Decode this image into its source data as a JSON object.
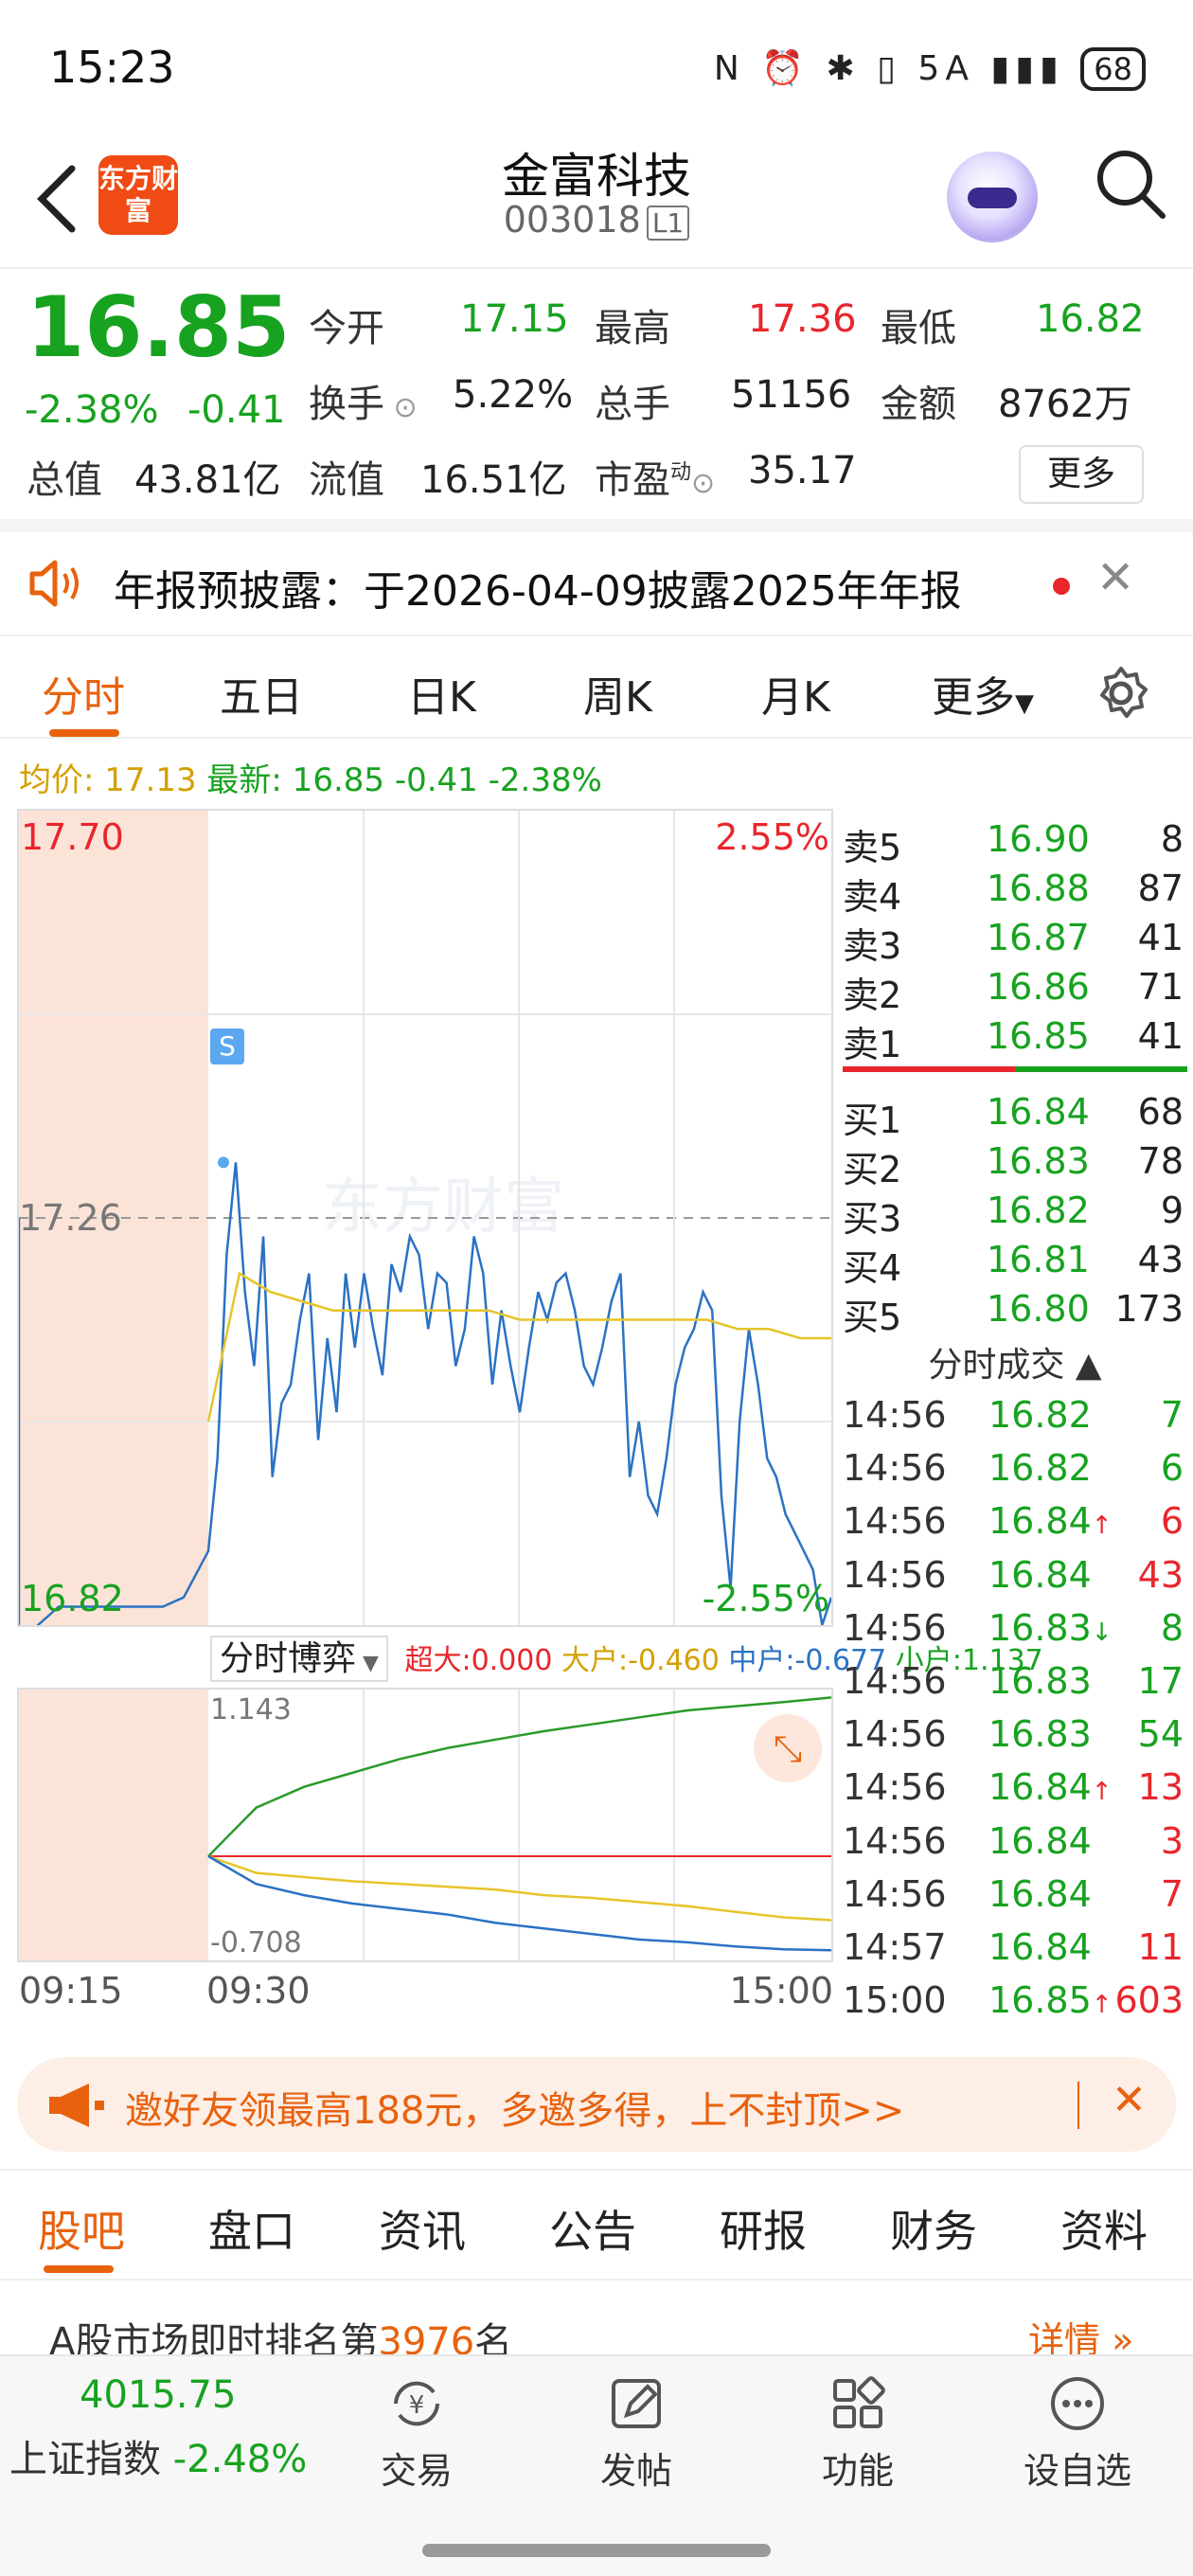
{
  "status": {
    "time": "15:23",
    "icons": "N ⏰ ✱ ▯ 5A ▮▮▮",
    "battery": "68"
  },
  "header": {
    "logo": "东方财富",
    "name": "金富科技",
    "code": "003018",
    "level": "L1"
  },
  "quote": {
    "price": "16.85",
    "pct": "-2.38%",
    "chg": "-0.41",
    "open_l": "今开",
    "open_v": "17.15",
    "high_l": "最高",
    "high_v": "17.36",
    "low_l": "最低",
    "low_v": "16.82",
    "turn_l": "换手",
    "turn_v": "5.22%",
    "vol_l": "总手",
    "vol_v": "51156",
    "amt_l": "金额",
    "amt_v": "8762万",
    "cap_l": "总值",
    "cap_v": "43.81亿",
    "fcap_l": "流值",
    "fcap_v": "16.51亿",
    "pe_l": "市盈",
    "pe_sup": "动",
    "pe_v": "35.17",
    "more": "更多"
  },
  "notice": {
    "text": "年报预披露：于2026-04-09披露2025年年报"
  },
  "tabs": [
    "分时",
    "五日",
    "日K",
    "周K",
    "月K",
    "更多"
  ],
  "legend": {
    "avg": "均价: 17.13",
    "latest": "最新: 16.85 -0.41 -2.38%"
  },
  "chart_data": {
    "type": "line",
    "top_price": "17.70",
    "top_pct": "2.55%",
    "mid_price": "17.26",
    "bot_price": "16.82",
    "bot_pct": "-2.55%",
    "marker": "S",
    "series": [
      {
        "values": [
          16.82,
          16.84,
          16.84,
          16.84,
          16.84,
          16.84,
          16.84,
          16.85,
          16.9,
          17.0,
          17.22,
          17.32,
          17.18,
          17.1,
          17.24,
          16.98,
          17.06,
          17.08,
          17.15,
          17.2,
          17.02,
          17.13,
          17.05,
          17.2,
          17.12,
          17.2,
          17.14,
          17.09,
          17.21,
          17.18,
          17.24,
          17.22,
          17.14,
          17.2,
          17.19,
          17.1,
          17.14,
          17.24,
          17.2,
          17.08,
          17.16,
          17.1,
          17.05,
          17.12,
          17.18,
          17.15,
          17.19,
          17.2,
          17.16,
          17.1,
          17.08,
          17.12,
          17.17,
          17.2,
          16.98,
          17.04,
          16.96,
          16.94,
          17.0,
          17.08,
          17.12,
          17.14,
          17.18,
          17.16,
          16.96,
          16.86,
          17.04,
          17.14,
          17.08,
          17.0,
          16.98,
          16.94,
          16.92,
          16.9,
          16.88,
          16.82,
          16.85
        ]
      },
      {
        "values": [
          17.04,
          17.2,
          17.18,
          17.17,
          17.16,
          17.16,
          17.16,
          17.16,
          17.16,
          17.16,
          17.15,
          17.15,
          17.15,
          17.15,
          17.15,
          17.15,
          17.15,
          17.14,
          17.14,
          17.13,
          17.13
        ]
      }
    ]
  },
  "game": {
    "label": "分时博弈",
    "big": "超大:0.000",
    "large": "大户:-0.460",
    "mid": "中户:-0.677",
    "small": "小户:1.137",
    "top": "1.143",
    "bot": "-0.708",
    "green": [
      0,
      0.35,
      0.5,
      0.6,
      0.7,
      0.78,
      0.84,
      0.9,
      0.95,
      1.0,
      1.05,
      1.08,
      1.11,
      1.143
    ],
    "yellow": [
      0,
      -0.12,
      -0.15,
      -0.18,
      -0.2,
      -0.22,
      -0.24,
      -0.28,
      -0.3,
      -0.33,
      -0.36,
      -0.4,
      -0.44,
      -0.46
    ],
    "blue": [
      0,
      -0.2,
      -0.28,
      -0.34,
      -0.38,
      -0.42,
      -0.48,
      -0.52,
      -0.56,
      -0.6,
      -0.62,
      -0.65,
      -0.67,
      -0.677
    ]
  },
  "times": [
    "09:15",
    "09:30",
    "15:00"
  ],
  "book": {
    "asks": [
      [
        "卖5",
        "16.90",
        "8"
      ],
      [
        "卖4",
        "16.88",
        "87"
      ],
      [
        "卖3",
        "16.87",
        "41"
      ],
      [
        "卖2",
        "16.86",
        "71"
      ],
      [
        "卖1",
        "16.85",
        "41"
      ]
    ],
    "bids": [
      [
        "买1",
        "16.84",
        "68"
      ],
      [
        "买2",
        "16.83",
        "78"
      ],
      [
        "买3",
        "16.82",
        "9"
      ],
      [
        "买4",
        "16.81",
        "43"
      ],
      [
        "买5",
        "16.80",
        "173"
      ]
    ],
    "trades_title": "分时成交",
    "trades": [
      [
        "14:56",
        "16.82",
        "",
        "7",
        "g"
      ],
      [
        "14:56",
        "16.82",
        "",
        "6",
        "g"
      ],
      [
        "14:56",
        "16.84",
        "↑",
        "6",
        "r"
      ],
      [
        "14:56",
        "16.84",
        "",
        "43",
        "r"
      ],
      [
        "14:56",
        "16.83",
        "↓",
        "8",
        "g"
      ],
      [
        "14:56",
        "16.83",
        "",
        "17",
        "g"
      ],
      [
        "14:56",
        "16.83",
        "",
        "54",
        "g"
      ],
      [
        "14:56",
        "16.84",
        "↑",
        "13",
        "r"
      ],
      [
        "14:56",
        "16.84",
        "",
        "3",
        "r"
      ],
      [
        "14:56",
        "16.84",
        "",
        "7",
        "r"
      ],
      [
        "14:57",
        "16.84",
        "",
        "11",
        "r"
      ],
      [
        "15:00",
        "16.85",
        "↑",
        "603",
        "r"
      ]
    ]
  },
  "banner": {
    "text": "邀好友领最高188元，多邀多得，上不封顶>>"
  },
  "content_tabs": [
    "股吧",
    "盘口",
    "资讯",
    "公告",
    "研报",
    "财务",
    "资料"
  ],
  "rank": {
    "prefix": "A股市场即时排名第",
    "num": "3976",
    "suffix": "名",
    "detail": "详情 »"
  },
  "bottom": {
    "index_val": "4015.75",
    "index_name": "上证指数",
    "index_pct": "-2.48%",
    "nav": [
      "交易",
      "发帖",
      "功能",
      "设自选"
    ]
  }
}
